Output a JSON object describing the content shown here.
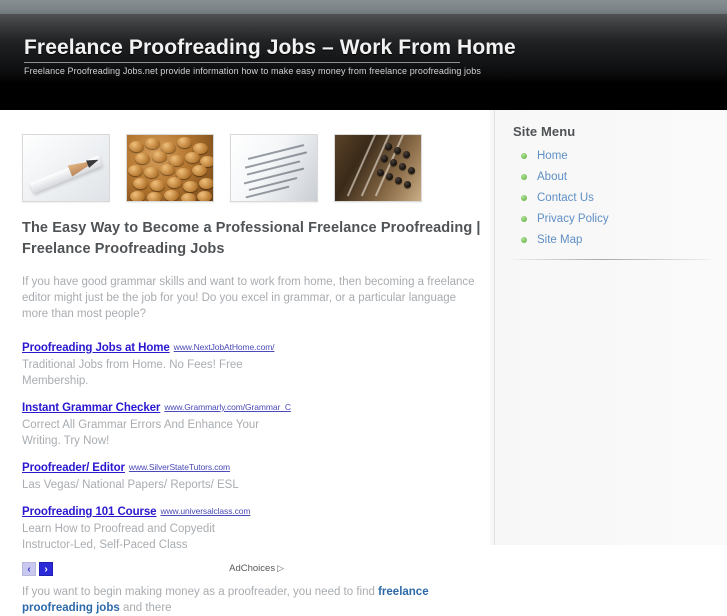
{
  "header": {
    "title": "Freelance Proofreading Jobs – Work From Home",
    "tagline": "Freelance Proofreading Jobs.net provide information how to make easy money from freelance proofreading jobs"
  },
  "banner": {
    "images": [
      {
        "name": "pencil-photo",
        "alt": "sharpened pencil on light surface"
      },
      {
        "name": "coins-photo",
        "alt": "pile of copper coins"
      },
      {
        "name": "printed-page-photo",
        "alt": "close-up of printed text page"
      },
      {
        "name": "abacus-photo",
        "alt": "old wooden abacus"
      }
    ]
  },
  "main": {
    "article_title": "The Easy Way to Become a Professional Freelance Proofreading | Freelance Proofreading Jobs",
    "intro_paragraph": "If you have good grammar skills and want to work from home, then becoming a freelance editor might just be the job for you! Do you excel in grammar, or a particular language more than most people?",
    "closing_paragraph_before": "If you want to begin making money as a proofreader, you need to find ",
    "closing_keyword_link": "freelance proofreading jobs",
    "closing_paragraph_after": " and there"
  },
  "ads": {
    "items": [
      {
        "headline": "Proofreading Jobs at Home",
        "url": "www.NextJobAtHome.com/",
        "description": "Traditional Jobs from Home. No Fees! Free Membership."
      },
      {
        "headline": "Instant Grammar Checker",
        "url": "www.Grammarly.com/Grammar_C",
        "description": "Correct All Grammar Errors And Enhance Your Writing. Try Now!"
      },
      {
        "headline": "Proofreader/ Editor",
        "url": "www.SilverStateTutors.com",
        "description": "Las Vegas/ National Papers/ Reports/ ESL"
      },
      {
        "headline": "Proofreading 101 Course",
        "url": "www.universalclass.com",
        "description": "Learn How to Proofread and Copyedit Instructor-Led, Self-Paced Class"
      }
    ],
    "pager_prev": "‹",
    "pager_next": "›",
    "adchoices_label": "AdChoices",
    "adchoices_glyph": "▷"
  },
  "sidebar": {
    "heading": "Site Menu",
    "items": [
      {
        "label": "Home"
      },
      {
        "label": "About"
      },
      {
        "label": "Contact Us"
      },
      {
        "label": "Privacy Policy"
      },
      {
        "label": "Site Map"
      }
    ]
  },
  "colors": {
    "header_dark": "#000000",
    "top_strip": "#7e8589",
    "heading_text": "#4f5356",
    "body_text": "#a8acb0",
    "ad_link": "#2a18cf",
    "sidebar_link": "#5f8fc4",
    "bullet_green": "#74bd56",
    "keyword_link": "#2e6aa8",
    "pager_active": "#2a2ad8"
  }
}
